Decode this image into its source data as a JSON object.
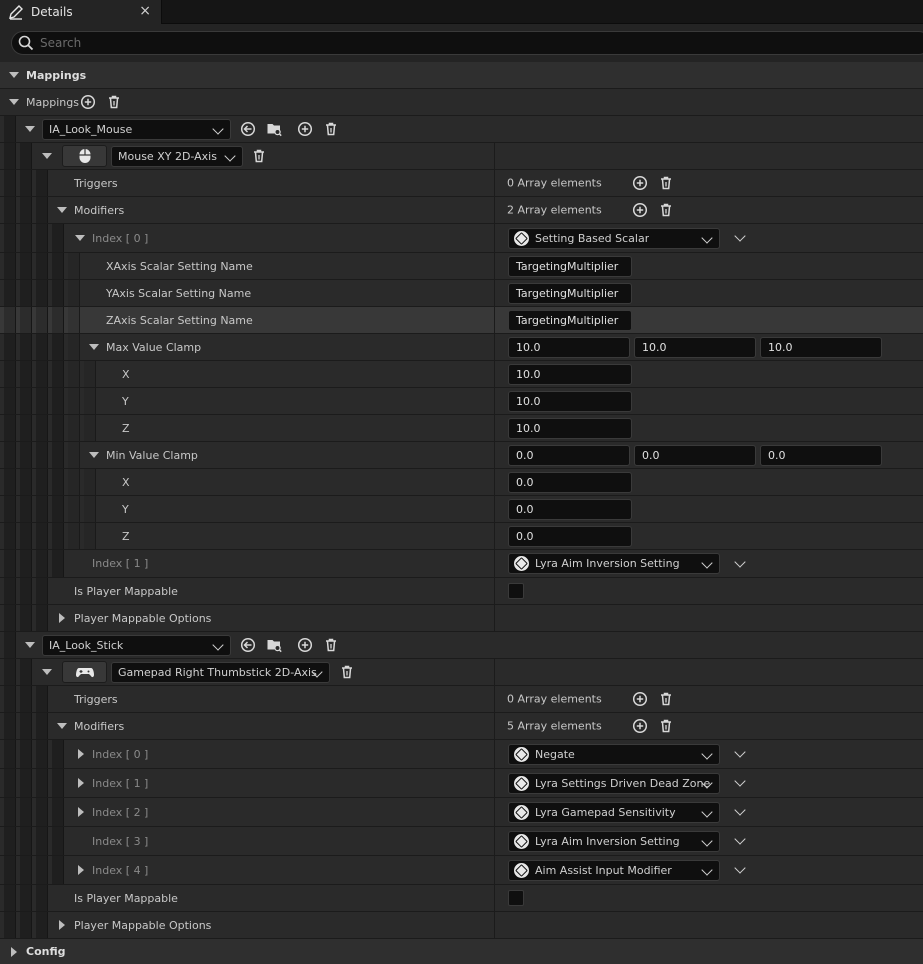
{
  "tab": {
    "label": "Details",
    "close": "×"
  },
  "search": {
    "placeholder": "Search"
  },
  "sections": {
    "mappings": "Mappings",
    "config": "Config"
  },
  "mappings_label": "Mappings",
  "labels": {
    "triggers": "Triggers",
    "modifiers": "Modifiers",
    "is_player_mappable": "Is Player Mappable",
    "player_mappable_options": "Player Mappable Options",
    "xaxis_setting": "XAxis Scalar Setting Name",
    "yaxis_setting": "YAxis Scalar Setting Name",
    "zaxis_setting": "ZAxis Scalar Setting Name",
    "max_value_clamp": "Max Value Clamp",
    "min_value_clamp": "Min Value Clamp",
    "x": "X",
    "y": "Y",
    "z": "Z"
  },
  "mapping1": {
    "action": "IA_Look_Mouse",
    "key": "Mouse XY 2D-Axis",
    "triggers_count": "0 Array elements",
    "modifiers_count": "2 Array elements",
    "index0_label": "Index [ 0 ]",
    "index0_value": "Setting Based Scalar",
    "xaxis_value": "TargetingMultiplier",
    "yaxis_value": "TargetingMultiplier",
    "zaxis_value": "TargetingMultiplier",
    "max_clamp": {
      "x": "10.0",
      "y": "10.0",
      "z": "10.0"
    },
    "min_clamp": {
      "x": "0.0",
      "y": "0.0",
      "z": "0.0"
    },
    "index1_label": "Index [ 1 ]",
    "index1_value": "Lyra Aim Inversion Setting"
  },
  "mapping2": {
    "action": "IA_Look_Stick",
    "key": "Gamepad Right Thumbstick 2D-Axis",
    "triggers_count": "0 Array elements",
    "modifiers_count": "5 Array elements",
    "indices": [
      {
        "label": "Index [ 0 ]",
        "value": "Negate"
      },
      {
        "label": "Index [ 1 ]",
        "value": "Lyra Settings Driven Dead Zone"
      },
      {
        "label": "Index [ 2 ]",
        "value": "Lyra Gamepad Sensitivity"
      },
      {
        "label": "Index [ 3 ]",
        "value": "Lyra Aim Inversion Setting"
      },
      {
        "label": "Index [ 4 ]",
        "value": "Aim Assist Input Modifier"
      }
    ]
  }
}
